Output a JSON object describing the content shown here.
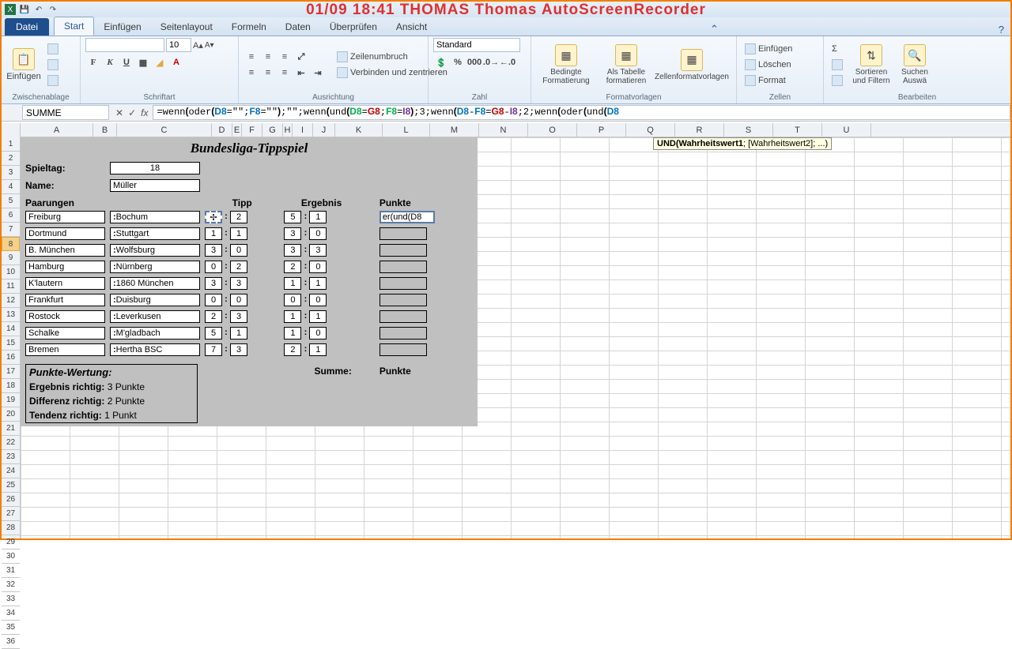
{
  "watermark": "01/09  18:41  THOMAS  Thomas  AutoScreenRecorder",
  "file_tab": "Datei",
  "tabs": [
    "Start",
    "Einfügen",
    "Seitenlayout",
    "Formeln",
    "Daten",
    "Überprüfen",
    "Ansicht"
  ],
  "active_tab": 0,
  "ribbon": {
    "clipboard": {
      "label": "Zwischenablage",
      "paste": "Einfügen"
    },
    "font": {
      "label": "Schriftart",
      "size": "10"
    },
    "align": {
      "label": "Ausrichtung",
      "wrap": "Zeilenumbruch",
      "merge": "Verbinden und zentrieren"
    },
    "number": {
      "label": "Zahl",
      "format": "Standard"
    },
    "styles": {
      "label": "Formatvorlagen",
      "cond": "Bedingte Formatierung",
      "table": "Als Tabelle formatieren",
      "cell": "Zellenformatvorlagen"
    },
    "cells": {
      "label": "Zellen",
      "insert": "Einfügen",
      "delete": "Löschen",
      "format": "Format"
    },
    "editing": {
      "label": "Bearbeiten",
      "sort": "Sortieren und Filtern",
      "find": "Suchen Auswä"
    }
  },
  "namebox": "SUMME",
  "formula": "=wenn(oder(D8=\"\";F8=\"\");\"\";wenn(und(D8=G8;F8=I8);3;wenn(D8-F8=G8-I8;2;wenn(oder(und(D8",
  "tooltip_text": "UND(Wahrheitswert1; [Wahrheitswert2]; ...)",
  "columns": [
    "A",
    "B",
    "C",
    "D",
    "E",
    "F",
    "G",
    "H",
    "I",
    "J",
    "K",
    "L",
    "M",
    "N",
    "O",
    "P",
    "Q",
    "R",
    "S",
    "T",
    "U"
  ],
  "rows": [
    "1",
    "2",
    "3",
    "4",
    "5",
    "6",
    "7",
    "8",
    "9",
    "10",
    "11",
    "12",
    "13",
    "14",
    "15",
    "16",
    "17",
    "18",
    "19",
    "20",
    "21",
    "22",
    "23",
    "24",
    "25",
    "26",
    "27",
    "28",
    "29",
    "30",
    "31",
    "32",
    "33",
    "34",
    "35",
    "36"
  ],
  "selected_row": "8",
  "sheet": {
    "title": "Bundesliga-Tippspiel",
    "spieltag_lbl": "Spieltag:",
    "spieltag_val": "18",
    "name_lbl": "Name:",
    "name_val": "Müller",
    "hdr_paarungen": "Paarungen",
    "hdr_tipp": "Tipp",
    "hdr_ergebnis": "Ergebnis",
    "hdr_punkte": "Punkte",
    "summe_lbl": "Summe:",
    "punkte_lbl": "Punkte",
    "pw_title": "Punkte-Wertung:",
    "pw1": "Ergebnis richtig:",
    "pw1v": "3 Punkte",
    "pw2": "Differenz richtig:",
    "pw2v": "2 Punkte",
    "pw3": "Tendenz richtig:",
    "pw3v": "1 Punkt",
    "edit_cell": "er(und(D8",
    "matches": [
      {
        "home": "Freiburg",
        "away": "Bochum",
        "t1": "",
        "t2": "2",
        "e1": "5",
        "e2": "1"
      },
      {
        "home": "Dortmund",
        "away": "Stuttgart",
        "t1": "1",
        "t2": "1",
        "e1": "3",
        "e2": "0"
      },
      {
        "home": "B. München",
        "away": "Wolfsburg",
        "t1": "3",
        "t2": "0",
        "e1": "3",
        "e2": "3"
      },
      {
        "home": "Hamburg",
        "away": "Nürnberg",
        "t1": "0",
        "t2": "2",
        "e1": "2",
        "e2": "0"
      },
      {
        "home": "K'lautern",
        "away": "1860 München",
        "t1": "3",
        "t2": "3",
        "e1": "1",
        "e2": "1"
      },
      {
        "home": "Frankfurt",
        "away": "Duisburg",
        "t1": "0",
        "t2": "0",
        "e1": "0",
        "e2": "0"
      },
      {
        "home": "Rostock",
        "away": "Leverkusen",
        "t1": "2",
        "t2": "3",
        "e1": "1",
        "e2": "1"
      },
      {
        "home": "Schalke",
        "away": "M'gladbach",
        "t1": "5",
        "t2": "1",
        "e1": "1",
        "e2": "0"
      },
      {
        "home": "Bremen",
        "away": "Hertha BSC",
        "t1": "7",
        "t2": "3",
        "e1": "2",
        "e2": "1"
      }
    ]
  }
}
